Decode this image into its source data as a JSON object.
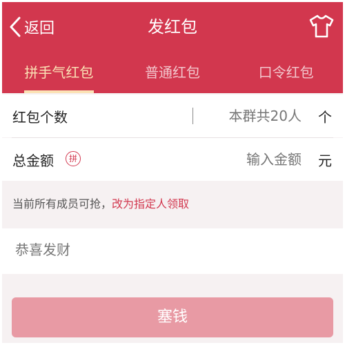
{
  "header": {
    "back_label": "返回",
    "title": "发红包",
    "bg_color": "#d2374e",
    "right_icon": "tshirt-icon"
  },
  "tabs": [
    {
      "label": "拼手气红包",
      "active": true
    },
    {
      "label": "普通红包",
      "active": false
    },
    {
      "label": "口令红包",
      "active": false
    }
  ],
  "count_row": {
    "label": "红包个数",
    "placeholder": "本群共20人",
    "unit": "个"
  },
  "amount_row": {
    "label": "总金额",
    "badge": "拼",
    "placeholder": "输入金额",
    "unit": "元"
  },
  "note": {
    "text": "当前所有成员可抢，",
    "link": "改为指定人领取"
  },
  "greeting": {
    "placeholder": "恭喜发财"
  },
  "submit": {
    "label": "塞钱",
    "color": "#e89aa4"
  }
}
